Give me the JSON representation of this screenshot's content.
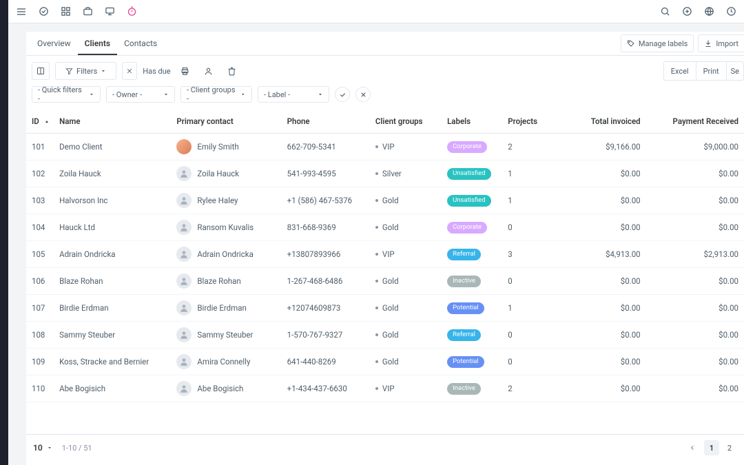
{
  "topbar": {
    "icons_left": [
      "menu-icon",
      "check-circle-icon",
      "grid-icon",
      "briefcase-icon",
      "monitor-icon",
      "stopwatch-icon"
    ],
    "icons_right": [
      "search-icon",
      "plus-circle-icon",
      "globe-icon",
      "clock-icon"
    ]
  },
  "tabs": {
    "items": [
      {
        "key": "overview",
        "label": "Overview",
        "active": false
      },
      {
        "key": "clients",
        "label": "Clients",
        "active": true
      },
      {
        "key": "contacts",
        "label": "Contacts",
        "active": false
      }
    ],
    "manage_labels": "Manage labels",
    "import": "Import"
  },
  "toolbar": {
    "filters": "Filters",
    "has_due": "Has due",
    "export_excel": "Excel",
    "export_print": "Print",
    "search_placeholder": "Se"
  },
  "filters": {
    "quick": "- Quick filters -",
    "owner": "- Owner -",
    "client_groups": "- Client groups -",
    "label": "- Label -"
  },
  "table": {
    "columns": {
      "id": "ID",
      "name": "Name",
      "primary_contact": "Primary contact",
      "phone": "Phone",
      "client_groups": "Client groups",
      "labels": "Labels",
      "projects": "Projects",
      "total_invoiced": "Total invoiced",
      "payment_received": "Payment Received"
    },
    "rows": [
      {
        "id": "101",
        "name": "Demo Client",
        "contact": "Emily Smith",
        "contact_has_photo": true,
        "phone": "662-709-5341",
        "group": "VIP",
        "label": "Corporate",
        "projects": "2",
        "invoiced": "$9,166.00",
        "payment": "$9,000.00"
      },
      {
        "id": "102",
        "name": "Zoila Hauck",
        "contact": "Zoila Hauck",
        "contact_has_photo": false,
        "phone": "541-993-4595",
        "group": "Silver",
        "label": "Unsatisfied",
        "projects": "1",
        "invoiced": "$0.00",
        "payment": "$0.00"
      },
      {
        "id": "103",
        "name": "Halvorson Inc",
        "contact": "Rylee Haley",
        "contact_has_photo": false,
        "phone": "+1 (586) 467-5376",
        "group": "Gold",
        "label": "Unsatisfied",
        "projects": "1",
        "invoiced": "$0.00",
        "payment": "$0.00"
      },
      {
        "id": "104",
        "name": "Hauck Ltd",
        "contact": "Ransom Kuvalis",
        "contact_has_photo": false,
        "phone": "831-668-9369",
        "group": "Gold",
        "label": "Corporate",
        "projects": "0",
        "invoiced": "$0.00",
        "payment": "$0.00"
      },
      {
        "id": "105",
        "name": "Adrain Ondricka",
        "contact": "Adrain Ondricka",
        "contact_has_photo": false,
        "phone": "+13807893966",
        "group": "VIP",
        "label": "Referral",
        "projects": "3",
        "invoiced": "$4,913.00",
        "payment": "$2,913.00"
      },
      {
        "id": "106",
        "name": "Blaze Rohan",
        "contact": "Blaze Rohan",
        "contact_has_photo": false,
        "phone": "1-267-468-6486",
        "group": "Gold",
        "label": "Inactive",
        "projects": "0",
        "invoiced": "$0.00",
        "payment": "$0.00"
      },
      {
        "id": "107",
        "name": "Birdie Erdman",
        "contact": "Birdie Erdman",
        "contact_has_photo": false,
        "phone": "+12074609873",
        "group": "Gold",
        "label": "Potential",
        "projects": "1",
        "invoiced": "$0.00",
        "payment": "$0.00"
      },
      {
        "id": "108",
        "name": "Sammy Steuber",
        "contact": "Sammy Steuber",
        "contact_has_photo": false,
        "phone": "1-570-767-9327",
        "group": "Gold",
        "label": "Referral",
        "projects": "0",
        "invoiced": "$0.00",
        "payment": "$0.00"
      },
      {
        "id": "109",
        "name": "Koss, Stracke and Bernier",
        "contact": "Amira Connelly",
        "contact_has_photo": false,
        "phone": "641-440-8269",
        "group": "Gold",
        "label": "Potential",
        "projects": "0",
        "invoiced": "$0.00",
        "payment": "$0.00"
      },
      {
        "id": "110",
        "name": "Abe Bogisich",
        "contact": "Abe Bogisich",
        "contact_has_photo": false,
        "phone": "+1-434-437-6630",
        "group": "VIP",
        "label": "Inactive",
        "projects": "2",
        "invoiced": "$0.00",
        "payment": "$0.00"
      }
    ]
  },
  "footer": {
    "per_page": "10",
    "range": "1-10 / 51",
    "pages": [
      "1",
      "2"
    ],
    "active_page": "1"
  }
}
